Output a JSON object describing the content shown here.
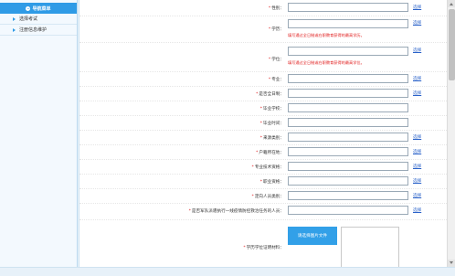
{
  "sidebar": {
    "header": "导航菜单",
    "items": [
      {
        "label": "选择考试"
      },
      {
        "label": "注册信息维护"
      }
    ]
  },
  "form": {
    "select_link": "选择",
    "rows": [
      {
        "label": "性别：",
        "required": true,
        "has_input": true,
        "has_select": true
      },
      {
        "label": "学历：",
        "required": true,
        "has_input": true,
        "has_select": true,
        "hint": "填写通过全日制或在职教育获得的最高学历。"
      },
      {
        "label": "学位：",
        "required": true,
        "has_input": true,
        "has_select": true,
        "hint": "填写通过全日制或在职教育获得的最高学位。"
      },
      {
        "label": "专业：",
        "required": true,
        "has_input": true,
        "has_select": true
      },
      {
        "label": "是否全日制：",
        "required": true,
        "has_input": true,
        "has_select": true
      },
      {
        "label": "毕业学校：",
        "required": true,
        "has_input": true,
        "has_select": false
      },
      {
        "label": "毕业时间：",
        "required": true,
        "has_input": true,
        "has_select": false
      },
      {
        "label": "来源类别：",
        "required": true,
        "has_input": true,
        "has_select": true
      },
      {
        "label": "户籍所在地：",
        "required": true,
        "has_input": true,
        "has_select": true
      },
      {
        "label": "专业技术资格：",
        "required": true,
        "has_input": true,
        "has_select": true
      },
      {
        "label": "职业资格：",
        "required": true,
        "has_input": true,
        "has_select": true
      },
      {
        "label": "定向人员类别：",
        "required": true,
        "has_input": true,
        "has_select": true
      },
      {
        "label": "是否军队派遣执行一线疫情防控救治任务的人员：",
        "required": true,
        "has_input": true,
        "has_select": true
      }
    ],
    "photo_label": "学历学位证明材料：",
    "upload_button": "请选择图片文件"
  }
}
